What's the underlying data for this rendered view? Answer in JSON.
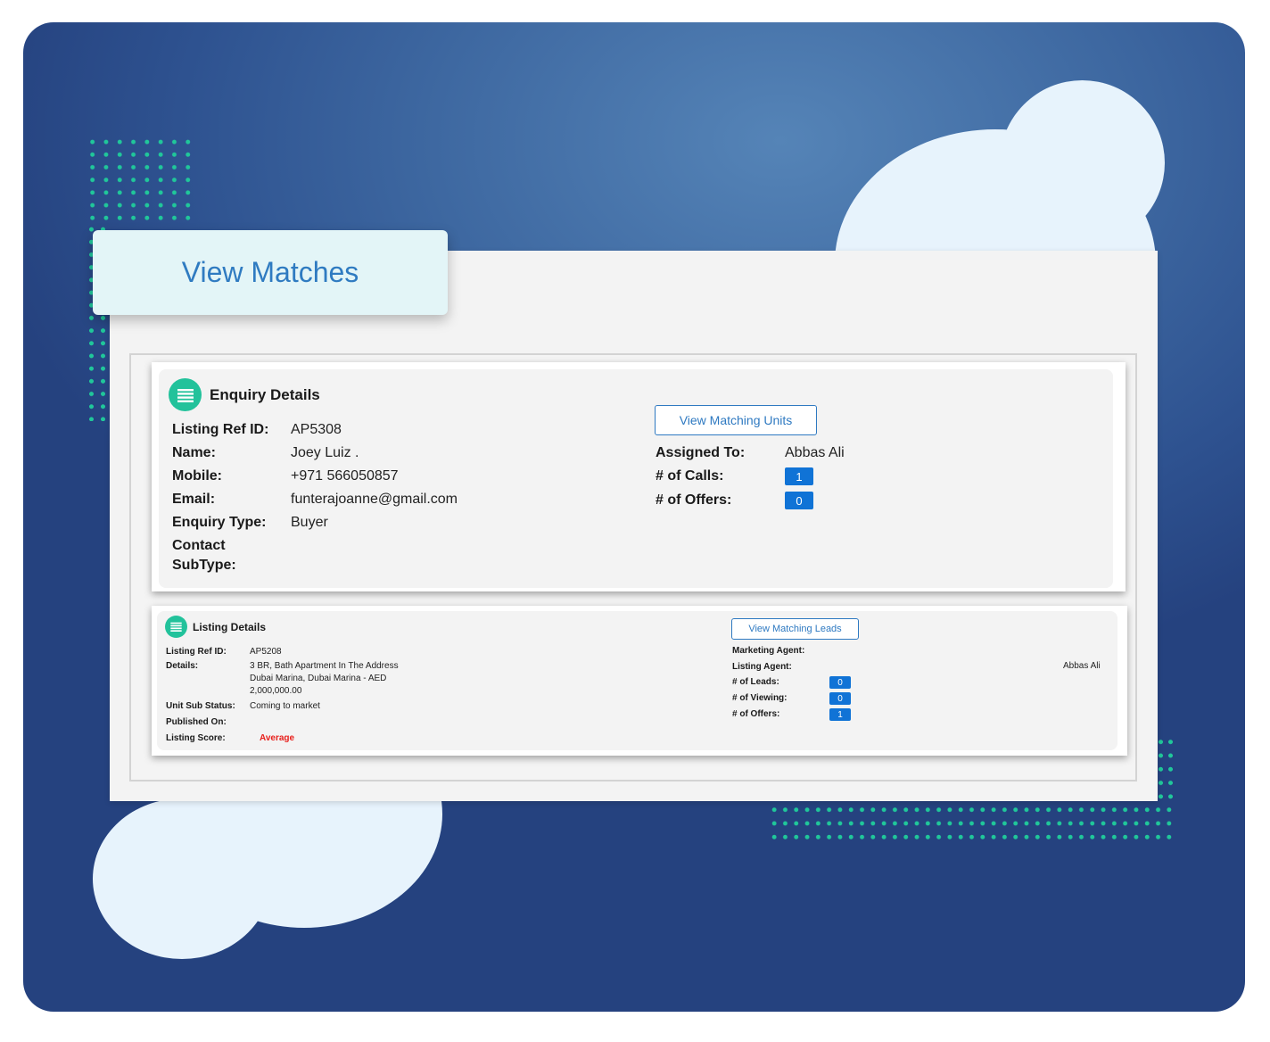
{
  "colors": {
    "accent": "#2e79c1",
    "badge": "#1073d6",
    "icon_green": "#22c29b",
    "score_red": "#e8201c"
  },
  "tab_title": "View Matches",
  "enquiry": {
    "title": "Enquiry Details",
    "icon": "list-icon",
    "labels": {
      "listing_ref": "Listing Ref ID:",
      "name": "Name:",
      "mobile": "Mobile:",
      "email": "Email:",
      "enquiry_type": "Enquiry Type:",
      "contact_subtype_1": "Contact",
      "contact_subtype_2": "SubType:",
      "assigned_to": "Assigned To:",
      "calls": "# of Calls:",
      "offers": "# of Offers:"
    },
    "values": {
      "listing_ref": "AP5308",
      "name": "Joey Luiz .",
      "mobile": "+971 566050857",
      "email": "funterajoanne@gmail.com",
      "enquiry_type": "Buyer",
      "assigned_to": "Abbas Ali",
      "calls": "1",
      "offers": "0"
    },
    "button": "View Matching Units"
  },
  "listing": {
    "title": "Listing Details",
    "icon": "list-icon",
    "labels": {
      "listing_ref": "Listing Ref ID:",
      "details": "Details:",
      "unit_sub_status": "Unit Sub Status:",
      "published_on": "Published On:",
      "listing_score": "Listing Score:",
      "marketing_agent": "Marketing Agent:",
      "listing_agent": "Listing Agent:",
      "leads": "# of Leads:",
      "viewing": "# of Viewing:",
      "offers": "# of Offers:"
    },
    "values": {
      "listing_ref": "AP5208",
      "details_1": "3 BR, Bath Apartment In The Address",
      "details_2": "Dubai Marina, Dubai Marina - AED",
      "details_3": "2,000,000.00",
      "unit_sub_status": "Coming to market",
      "listing_score": "Average",
      "listing_agent": "Abbas Ali",
      "leads": "0",
      "viewing": "0",
      "offers": "1"
    },
    "button": "View Matching Leads"
  }
}
